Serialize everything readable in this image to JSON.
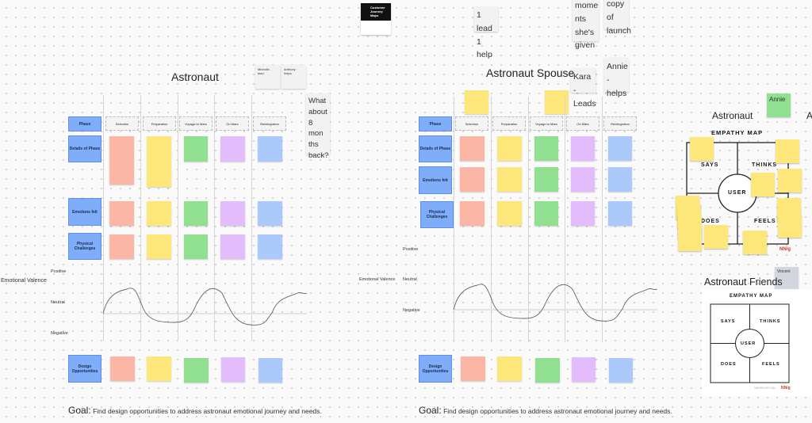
{
  "canvas": {
    "background": "#fafafa",
    "colors": {
      "phase_blue": "#7fadf9",
      "pink": "#fbb6a5",
      "yellow": "#fde77a",
      "green": "#91df91",
      "purple": "#e3bdfb",
      "light_blue": "#acc9fb"
    }
  },
  "top_cards": {
    "template_title": "Customer Journey Maps",
    "lead_help": "1 lead 1 help",
    "moments": "mome nts she's given",
    "copy": "copy of launch",
    "kara": "Kara - Leads",
    "annie_helps": "Annie - helps"
  },
  "map1": {
    "title": "Astronaut",
    "cards": {
      "michelle": "Michelle - lead",
      "anthony": "Anthony helps",
      "question": "What about 8 mon ths back?"
    },
    "rows": {
      "phase": "Phase",
      "details": "Details of Phase",
      "emotions": "Emotions felt",
      "physical": "Physical Challenges",
      "design": "Design Opportunities"
    },
    "phases": [
      "Selection",
      "Preparation",
      "Voyage to Mars",
      "On Mars",
      "Reintegration"
    ],
    "valence": {
      "label": "Emotional Valence",
      "positive": "Positive",
      "neutral": "Neutral",
      "negative": "Negative"
    },
    "goal_label": "Goal:",
    "goal_text": "Find design opportunities to address astronaut emotional journey and needs."
  },
  "map2": {
    "title": "Astronaut Spouse",
    "rows": {
      "phase": "Phase",
      "details": "Details of Phase",
      "emotions": "Emotions felt",
      "physical": "Physical Challenges",
      "design": "Design Opportunities"
    },
    "phases": [
      "Selection",
      "Preparation",
      "Voyage to Mars",
      "On Mars",
      "Reintegration"
    ],
    "valence": {
      "label": "Emotional Valence",
      "positive": "Positive",
      "neutral": "Neutral",
      "negative": "Negative"
    },
    "goal_label": "Goal:",
    "goal_text": "Find design opportunities to address astronaut emotional journey and needs."
  },
  "empathy1": {
    "title": "Astronaut",
    "card": "Annie",
    "map_title": "EMPATHY MAP",
    "says": "SAYS",
    "thinks": "THINKS",
    "does": "DOES",
    "feels": "FEELS",
    "user": "USER",
    "cut_title": "A"
  },
  "empathy2": {
    "title": "Astronaut Friends",
    "card": "Vincent",
    "map_title": "EMPATHY MAP",
    "says": "SAYS",
    "thinks": "THINKS",
    "does": "DOES",
    "feels": "FEELS",
    "user": "USER",
    "footer": "NNGROUP.COM"
  }
}
